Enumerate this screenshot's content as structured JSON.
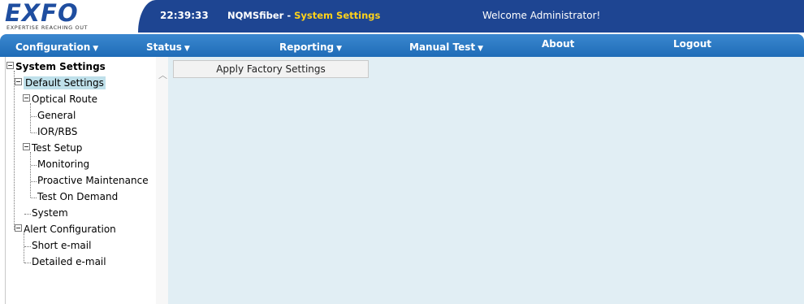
{
  "header": {
    "logo_text": "EXFO",
    "logo_tagline": "EXPERTISE REACHING OUT",
    "time": "22:39:33",
    "app_name": "NQMSfiber",
    "separator": " - ",
    "page_name": "System Settings",
    "welcome": "Welcome Administrator!"
  },
  "menu": {
    "configuration": "Configuration",
    "status": "Status",
    "reporting": "Reporting",
    "manual_test": "Manual Test",
    "about": "About",
    "logout": "Logout",
    "caret": "▼"
  },
  "tree": {
    "root": "System Settings",
    "default_settings": "Default Settings",
    "optical_route": "Optical Route",
    "general": "General",
    "ior_rbs": "IOR/RBS",
    "test_setup": "Test Setup",
    "monitoring": "Monitoring",
    "proactive_maintenance": "Proactive Maintenance",
    "test_on_demand": "Test On Demand",
    "system": "System",
    "alert_configuration": "Alert Configuration",
    "short_email": "Short e-mail",
    "detailed_email": "Detailed e-mail"
  },
  "content": {
    "apply_button": "Apply Factory Settings"
  },
  "colors": {
    "header_bg": "#1e4592",
    "menu_bg": "#2a78c3",
    "highlight_yellow": "#ffd21a",
    "content_bg": "#e1eef4",
    "selected_bg": "#bfe0ea"
  }
}
